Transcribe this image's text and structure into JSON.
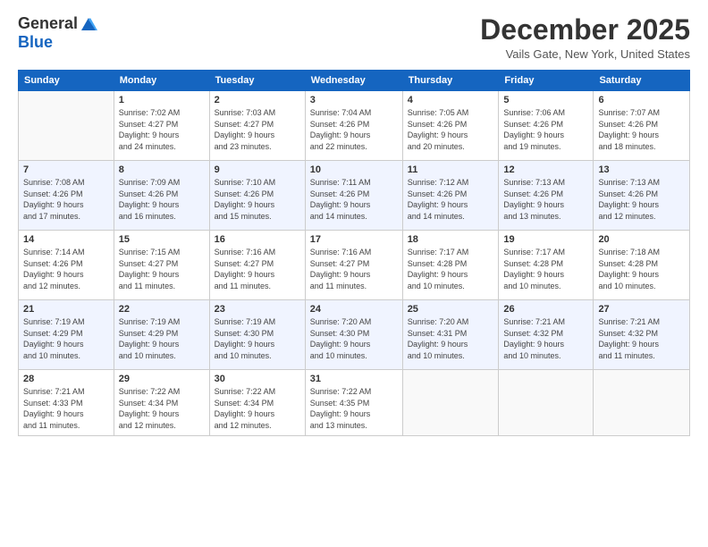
{
  "logo": {
    "line1": "General",
    "line2": "Blue"
  },
  "header": {
    "title": "December 2025",
    "location": "Vails Gate, New York, United States"
  },
  "weekdays": [
    "Sunday",
    "Monday",
    "Tuesday",
    "Wednesday",
    "Thursday",
    "Friday",
    "Saturday"
  ],
  "weeks": [
    [
      {
        "day": "",
        "info": ""
      },
      {
        "day": "1",
        "info": "Sunrise: 7:02 AM\nSunset: 4:27 PM\nDaylight: 9 hours\nand 24 minutes."
      },
      {
        "day": "2",
        "info": "Sunrise: 7:03 AM\nSunset: 4:27 PM\nDaylight: 9 hours\nand 23 minutes."
      },
      {
        "day": "3",
        "info": "Sunrise: 7:04 AM\nSunset: 4:26 PM\nDaylight: 9 hours\nand 22 minutes."
      },
      {
        "day": "4",
        "info": "Sunrise: 7:05 AM\nSunset: 4:26 PM\nDaylight: 9 hours\nand 20 minutes."
      },
      {
        "day": "5",
        "info": "Sunrise: 7:06 AM\nSunset: 4:26 PM\nDaylight: 9 hours\nand 19 minutes."
      },
      {
        "day": "6",
        "info": "Sunrise: 7:07 AM\nSunset: 4:26 PM\nDaylight: 9 hours\nand 18 minutes."
      }
    ],
    [
      {
        "day": "7",
        "info": "Sunrise: 7:08 AM\nSunset: 4:26 PM\nDaylight: 9 hours\nand 17 minutes."
      },
      {
        "day": "8",
        "info": "Sunrise: 7:09 AM\nSunset: 4:26 PM\nDaylight: 9 hours\nand 16 minutes."
      },
      {
        "day": "9",
        "info": "Sunrise: 7:10 AM\nSunset: 4:26 PM\nDaylight: 9 hours\nand 15 minutes."
      },
      {
        "day": "10",
        "info": "Sunrise: 7:11 AM\nSunset: 4:26 PM\nDaylight: 9 hours\nand 14 minutes."
      },
      {
        "day": "11",
        "info": "Sunrise: 7:12 AM\nSunset: 4:26 PM\nDaylight: 9 hours\nand 14 minutes."
      },
      {
        "day": "12",
        "info": "Sunrise: 7:13 AM\nSunset: 4:26 PM\nDaylight: 9 hours\nand 13 minutes."
      },
      {
        "day": "13",
        "info": "Sunrise: 7:13 AM\nSunset: 4:26 PM\nDaylight: 9 hours\nand 12 minutes."
      }
    ],
    [
      {
        "day": "14",
        "info": "Sunrise: 7:14 AM\nSunset: 4:26 PM\nDaylight: 9 hours\nand 12 minutes."
      },
      {
        "day": "15",
        "info": "Sunrise: 7:15 AM\nSunset: 4:27 PM\nDaylight: 9 hours\nand 11 minutes."
      },
      {
        "day": "16",
        "info": "Sunrise: 7:16 AM\nSunset: 4:27 PM\nDaylight: 9 hours\nand 11 minutes."
      },
      {
        "day": "17",
        "info": "Sunrise: 7:16 AM\nSunset: 4:27 PM\nDaylight: 9 hours\nand 11 minutes."
      },
      {
        "day": "18",
        "info": "Sunrise: 7:17 AM\nSunset: 4:28 PM\nDaylight: 9 hours\nand 10 minutes."
      },
      {
        "day": "19",
        "info": "Sunrise: 7:17 AM\nSunset: 4:28 PM\nDaylight: 9 hours\nand 10 minutes."
      },
      {
        "day": "20",
        "info": "Sunrise: 7:18 AM\nSunset: 4:28 PM\nDaylight: 9 hours\nand 10 minutes."
      }
    ],
    [
      {
        "day": "21",
        "info": "Sunrise: 7:19 AM\nSunset: 4:29 PM\nDaylight: 9 hours\nand 10 minutes."
      },
      {
        "day": "22",
        "info": "Sunrise: 7:19 AM\nSunset: 4:29 PM\nDaylight: 9 hours\nand 10 minutes."
      },
      {
        "day": "23",
        "info": "Sunrise: 7:19 AM\nSunset: 4:30 PM\nDaylight: 9 hours\nand 10 minutes."
      },
      {
        "day": "24",
        "info": "Sunrise: 7:20 AM\nSunset: 4:30 PM\nDaylight: 9 hours\nand 10 minutes."
      },
      {
        "day": "25",
        "info": "Sunrise: 7:20 AM\nSunset: 4:31 PM\nDaylight: 9 hours\nand 10 minutes."
      },
      {
        "day": "26",
        "info": "Sunrise: 7:21 AM\nSunset: 4:32 PM\nDaylight: 9 hours\nand 10 minutes."
      },
      {
        "day": "27",
        "info": "Sunrise: 7:21 AM\nSunset: 4:32 PM\nDaylight: 9 hours\nand 11 minutes."
      }
    ],
    [
      {
        "day": "28",
        "info": "Sunrise: 7:21 AM\nSunset: 4:33 PM\nDaylight: 9 hours\nand 11 minutes."
      },
      {
        "day": "29",
        "info": "Sunrise: 7:22 AM\nSunset: 4:34 PM\nDaylight: 9 hours\nand 12 minutes."
      },
      {
        "day": "30",
        "info": "Sunrise: 7:22 AM\nSunset: 4:34 PM\nDaylight: 9 hours\nand 12 minutes."
      },
      {
        "day": "31",
        "info": "Sunrise: 7:22 AM\nSunset: 4:35 PM\nDaylight: 9 hours\nand 13 minutes."
      },
      {
        "day": "",
        "info": ""
      },
      {
        "day": "",
        "info": ""
      },
      {
        "day": "",
        "info": ""
      }
    ]
  ]
}
